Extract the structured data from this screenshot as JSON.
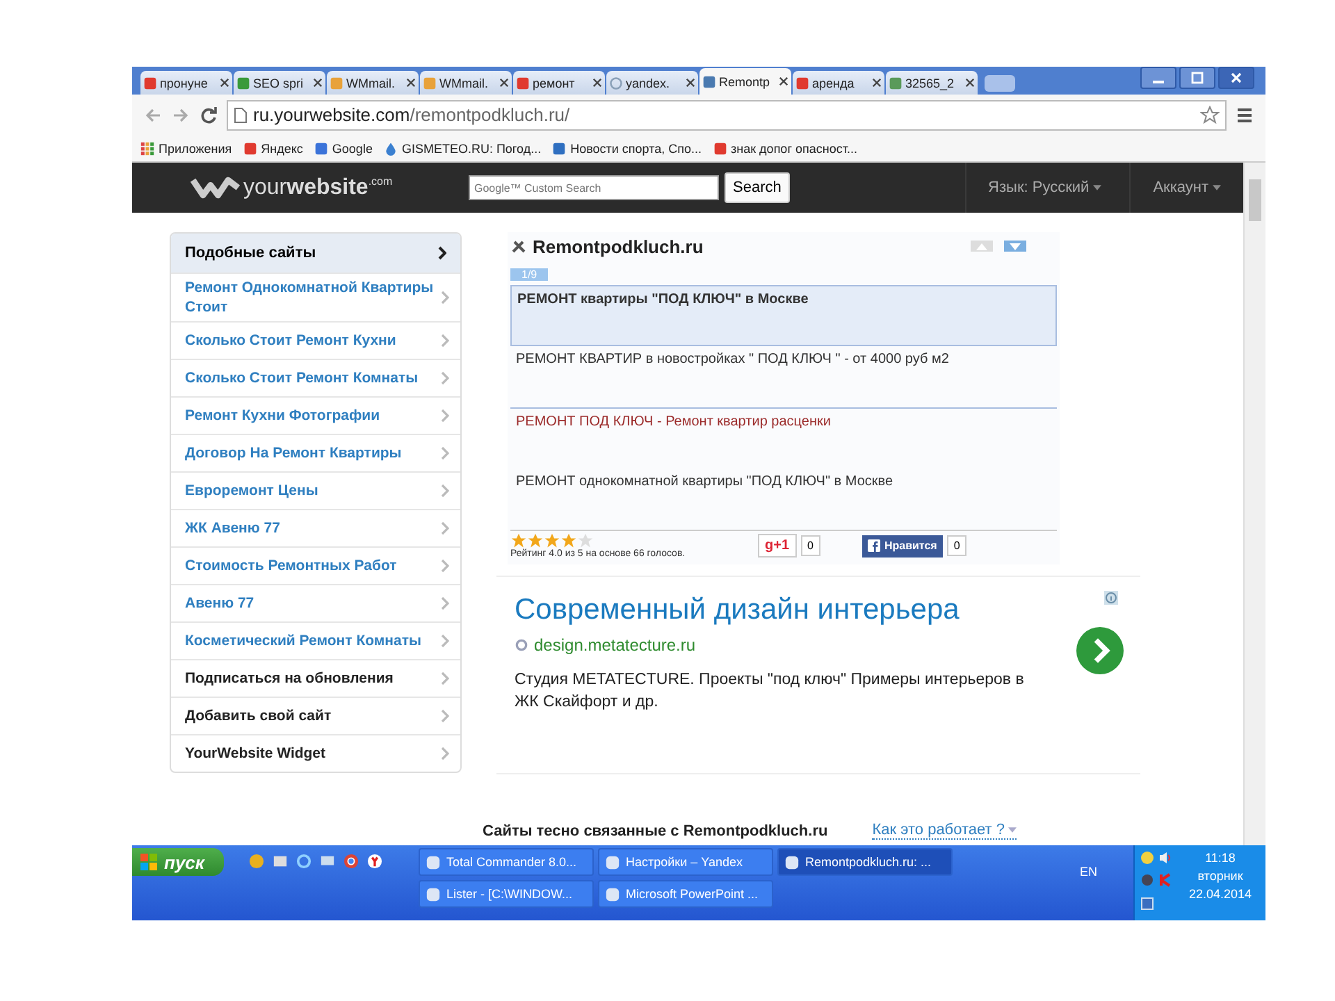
{
  "browser": {
    "tabs": [
      {
        "label": "пронуне",
        "kind": "yandex",
        "selected": false
      },
      {
        "label": "SEO spri",
        "kind": "seo",
        "selected": false
      },
      {
        "label": "WMmail.",
        "kind": "mail",
        "selected": false
      },
      {
        "label": "WMmail.",
        "kind": "mail",
        "selected": false
      },
      {
        "label": "ремонт",
        "kind": "yandex",
        "selected": false
      },
      {
        "label": "yandex.",
        "kind": "loading",
        "selected": false
      },
      {
        "label": "Remontp",
        "kind": "site",
        "selected": true
      },
      {
        "label": "аренда",
        "kind": "yandex",
        "selected": false
      },
      {
        "label": "32565_2",
        "kind": "image",
        "selected": false
      }
    ],
    "url_host": "ru.yourwebsite.com",
    "url_path": "/remontpodkluch.ru/",
    "bookmarks": [
      {
        "label": "Приложения",
        "kind": "apps"
      },
      {
        "label": "Яндекс",
        "kind": "yandex"
      },
      {
        "label": "Google",
        "kind": "google"
      },
      {
        "label": "GISMETEO.RU: Погод...",
        "kind": "drop"
      },
      {
        "label": "Новости спорта, Спо...",
        "kind": "news"
      },
      {
        "label": "знак допог опасност...",
        "kind": "yandex"
      }
    ]
  },
  "site_header": {
    "logo": "your**website**$^{.com}$",
    "search_placeholder": "Google™ Custom Search",
    "search_button": "Search",
    "menu": [
      "Язык: Русский",
      "Аккаунт"
    ]
  },
  "sidebar": {
    "heading": "Подобные сайты",
    "items": [
      {
        "label": "Ремонт Однокомнатной Квартиры Стоит",
        "kind": "link"
      },
      {
        "label": "Сколько Стоит Ремонт Кухни",
        "kind": "link"
      },
      {
        "label": "Сколько Стоит Ремонт Комнаты",
        "kind": "link"
      },
      {
        "label": "Ремонт Кухни Фотографии",
        "kind": "link"
      },
      {
        "label": "Договор На Ремонт Квартиры",
        "kind": "link"
      },
      {
        "label": "Евроремонт Цены",
        "kind": "link"
      },
      {
        "label": "ЖК Авеню 77",
        "kind": "link"
      },
      {
        "label": "Стоимость Ремонтных Работ",
        "kind": "link"
      },
      {
        "label": "Авеню 77",
        "kind": "link"
      },
      {
        "label": "Косметический Ремонт Комнаты",
        "kind": "link"
      },
      {
        "label": "Подписаться на обновления",
        "kind": "action"
      },
      {
        "label": "Добавить свой сайт",
        "kind": "action"
      },
      {
        "label": "YourWebsite Widget",
        "kind": "action"
      }
    ]
  },
  "main_card": {
    "title": "Remontpodkluch.ru",
    "counter": "1/9",
    "results": [
      {
        "text": "РЕМОНТ квартиры \"ПОД КЛЮЧ\" в Москве",
        "selected": true,
        "visited": false
      },
      {
        "text": "РЕМОНТ КВАРТИР в новостройках \" ПОД КЛЮЧ \" - от 4000 руб м2",
        "selected": false,
        "visited": false
      },
      {
        "text": "РЕМОНТ ПОД КЛЮЧ - Ремонт квартир расценки",
        "selected": false,
        "visited": true
      },
      {
        "text": "РЕМОНТ однокомнатной квартиры \"ПОД КЛЮЧ\" в Москве",
        "selected": false,
        "visited": false
      }
    ],
    "rating": {
      "stars": 4,
      "text": "Рейтинг 4.0 из 5 на основе 66 голосов."
    },
    "gplus": {
      "label": "g+1",
      "count": "0"
    },
    "facebook": {
      "label": "Нравится",
      "count": "0"
    }
  },
  "ad": {
    "title": "Современный дизайн интерьера",
    "url": "design.metatecture.ru",
    "text": "Студия METATECTURE. Проекты \"под ключ\" Примеры интерьеров в ЖК Скайфорт и др."
  },
  "related": {
    "heading": "Сайты тесно связанные с Remontpodkluch.ru",
    "link": "Как это работает ?"
  },
  "taskbar": {
    "start": "пуск",
    "tasks": [
      {
        "label": "Total Commander 8.0...",
        "selected": false
      },
      {
        "label": "Настройки – Yandex",
        "selected": false
      },
      {
        "label": "Remontpodkluch.ru: ...",
        "selected": true
      },
      {
        "label": "Lister - [C:\\WINDOW...",
        "selected": false
      },
      {
        "label": "Microsoft PowerPoint ...",
        "selected": false
      }
    ],
    "language": "EN",
    "time": "11:18",
    "weekday": "вторник",
    "date": "22.04.2014"
  }
}
